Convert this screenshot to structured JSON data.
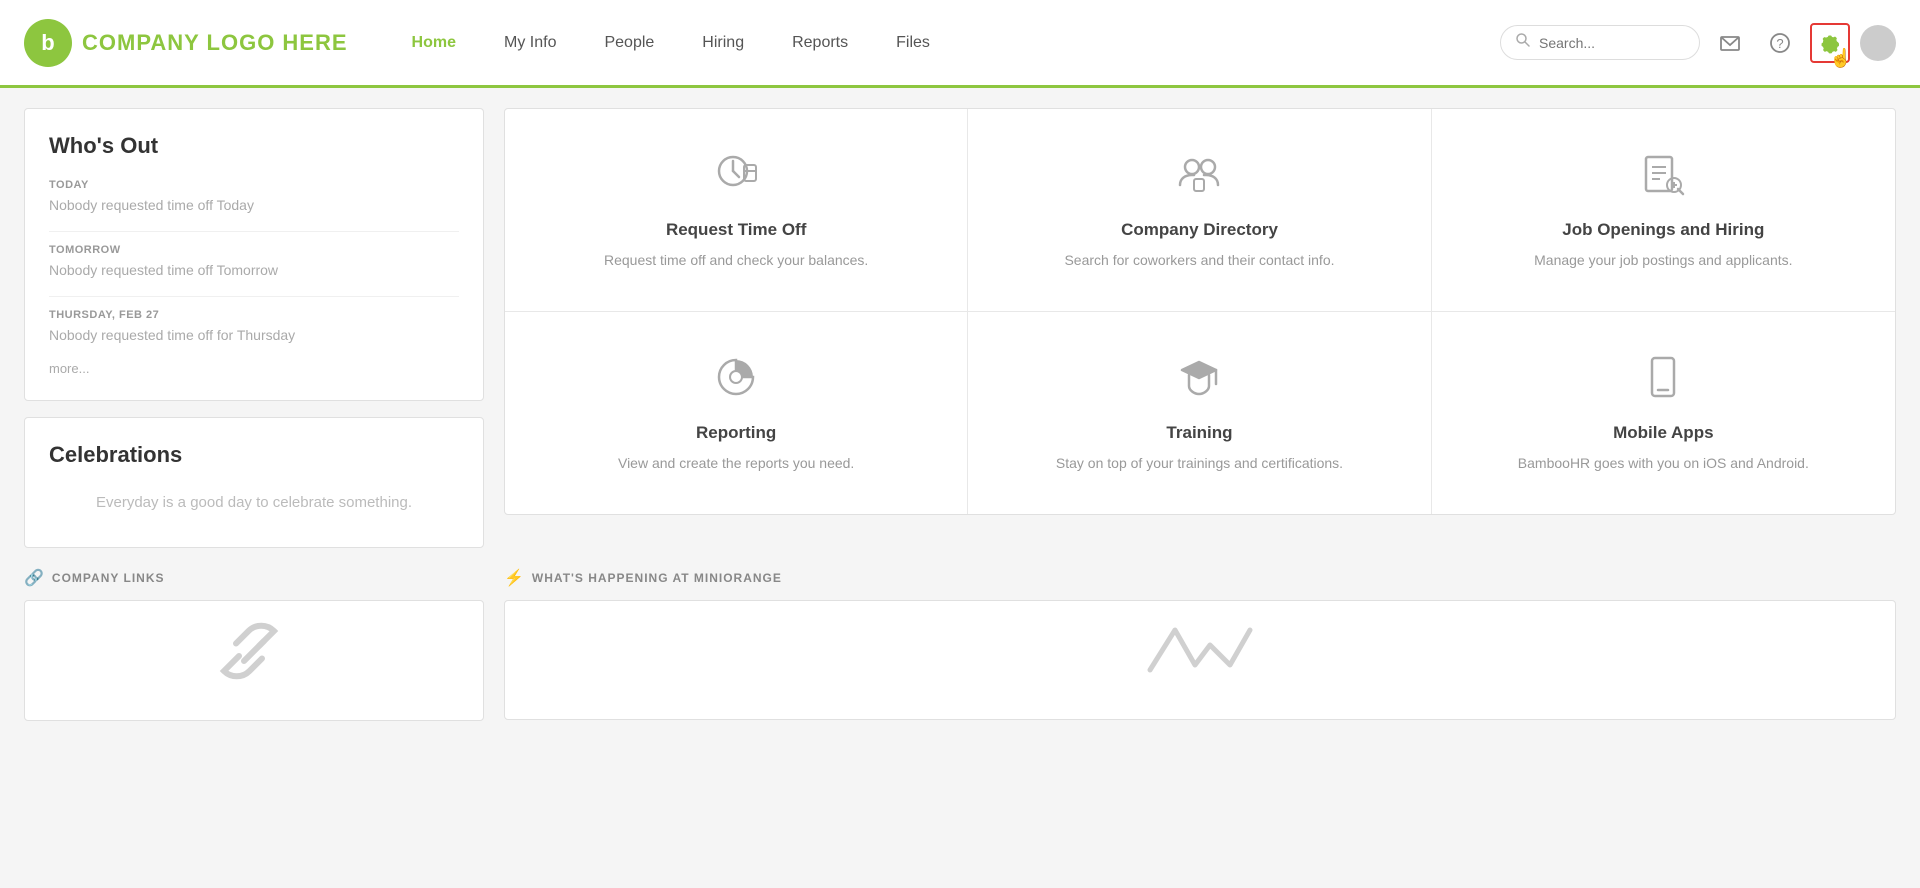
{
  "header": {
    "logo_letter": "b",
    "logo_alt_text": "COMPANY LOGO HERE",
    "nav": [
      {
        "label": "Home",
        "active": true
      },
      {
        "label": "My Info",
        "active": false
      },
      {
        "label": "People",
        "active": false
      },
      {
        "label": "Hiring",
        "active": false
      },
      {
        "label": "Reports",
        "active": false
      },
      {
        "label": "Files",
        "active": false
      }
    ],
    "search_placeholder": "Search...",
    "search_label": "Search"
  },
  "whos_out": {
    "title": "Who's Out",
    "today_label": "TODAY",
    "today_text": "Nobody requested time off Today",
    "tomorrow_label": "TOMORROW",
    "tomorrow_text": "Nobody requested time off Tomorrow",
    "thursday_label": "THURSDAY, FEB 27",
    "thursday_text": "Nobody requested time off for Thursday",
    "more_label": "more..."
  },
  "celebrations": {
    "title": "Celebrations",
    "empty_text": "Everyday is a good day to celebrate something."
  },
  "quick_links": [
    {
      "icon": "⏱",
      "title": "Request Time Off",
      "desc": "Request time off and check your balances."
    },
    {
      "icon": "👥",
      "title": "Company Directory",
      "desc": "Search for coworkers and their contact info."
    },
    {
      "icon": "📋",
      "title": "Job Openings and Hiring",
      "desc": "Manage your job postings and applicants."
    },
    {
      "icon": "🥧",
      "title": "Reporting",
      "desc": "View and create the reports you need."
    },
    {
      "icon": "🎓",
      "title": "Training",
      "desc": "Stay on top of your trainings and certifications."
    },
    {
      "icon": "📱",
      "title": "Mobile Apps",
      "desc": "BambooHR goes with you on iOS and Android."
    }
  ],
  "company_links": {
    "section_label": "COMPANY LINKS",
    "icon": "🔗"
  },
  "whats_happening": {
    "section_label": "WHAT'S HAPPENING AT MINIORANGE",
    "icon": "⚡"
  }
}
